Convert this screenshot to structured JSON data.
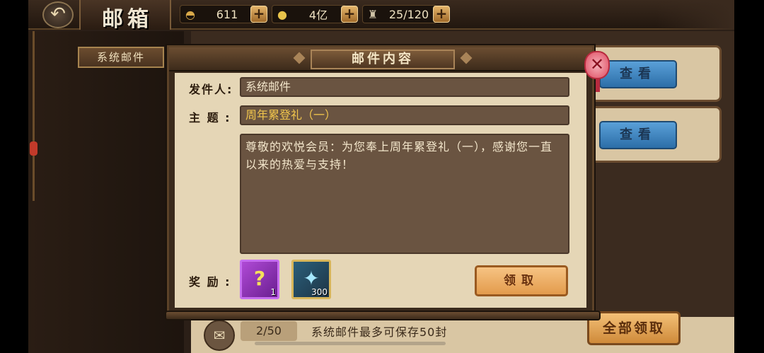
{
  "header": {
    "back_glyph": "↶",
    "title": "邮箱",
    "resources": [
      {
        "icon": "gold-ingot-icon",
        "glyph": "◓",
        "value": "611"
      },
      {
        "icon": "coin-icon",
        "glyph": "●",
        "value": "4亿"
      },
      {
        "icon": "stamina-icon",
        "glyph": "♜",
        "value": "25/120"
      }
    ],
    "plus": "+"
  },
  "sidebar": {
    "tab_label": "系统邮件"
  },
  "mail_list": {
    "view_label": "查看",
    "count": "2/50",
    "capacity_note": "系统邮件最多可保存50封",
    "collect_all_label": "全部领取",
    "mail_icon_glyph": "✉"
  },
  "dialog": {
    "title": "邮件内容",
    "sender_label": "发件人:",
    "sender_value": "系统邮件",
    "subject_label": "主 题 :",
    "subject_value": "周年累登礼（一）",
    "content": "尊敬的欢悦会员：为您奉上周年累登礼（一），感谢您一直以来的热爱与支持！",
    "reward_label": "奖 励 :",
    "rewards": [
      {
        "icon": "mystery-gem-icon",
        "glyph": "?",
        "count": "1",
        "color": "#b04ad6"
      },
      {
        "icon": "crystal-shard-icon",
        "glyph": "✦",
        "count": "300",
        "color": "#2b5f7a"
      }
    ],
    "claim_label": "领取",
    "close_glyph": "✕"
  }
}
